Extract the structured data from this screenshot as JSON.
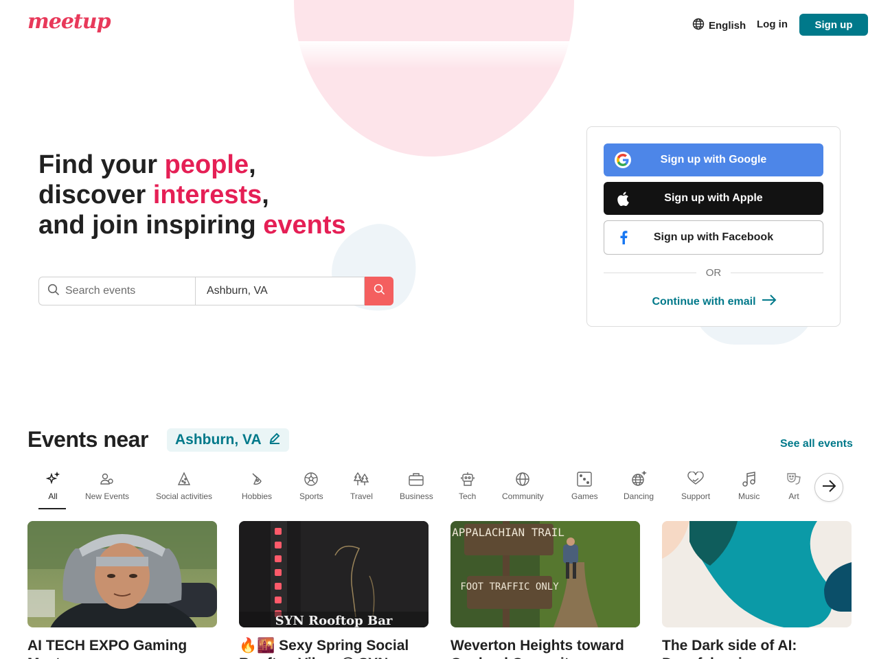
{
  "header": {
    "logo": "meetup",
    "language": "English",
    "login": "Log in",
    "signup": "Sign up"
  },
  "hero": {
    "line1_pre": "Find your ",
    "line1_hl": "people",
    "line1_post": ",",
    "line2_pre": "discover ",
    "line2_hl": "interests",
    "line2_post": ",",
    "line3_pre": "and join inspiring ",
    "line3_hl": "events"
  },
  "search": {
    "placeholder": "Search events",
    "location": "Ashburn, VA"
  },
  "signup_card": {
    "google": "Sign up with Google",
    "apple": "Sign up with Apple",
    "facebook": "Sign up with Facebook",
    "or": "OR",
    "email": "Continue with email"
  },
  "events": {
    "title": "Events near",
    "location": "Ashburn, VA",
    "see_all": "See all events",
    "categories": [
      {
        "label": "All",
        "icon": "sparkle-icon",
        "active": true
      },
      {
        "label": "New Events",
        "icon": "new-people-icon"
      },
      {
        "label": "Social activities",
        "icon": "party-hat-icon"
      },
      {
        "label": "Hobbies",
        "icon": "palette-icon"
      },
      {
        "label": "Sports",
        "icon": "soccer-ball-icon"
      },
      {
        "label": "Travel",
        "icon": "trees-icon"
      },
      {
        "label": "Business",
        "icon": "briefcase-icon"
      },
      {
        "label": "Tech",
        "icon": "robot-icon"
      },
      {
        "label": "Community",
        "icon": "globe-icon"
      },
      {
        "label": "Games",
        "icon": "dice-icon"
      },
      {
        "label": "Dancing",
        "icon": "disco-ball-icon"
      },
      {
        "label": "Support",
        "icon": "heart-hands-icon"
      },
      {
        "label": "Music",
        "icon": "music-note-icon"
      },
      {
        "label": "Art",
        "icon": "theater-masks-icon"
      }
    ],
    "cards": [
      {
        "title": "AI TECH EXPO Gaming Meet"
      },
      {
        "title": "🔥🌇 Sexy Spring Social Rooftop Vibes @ SYN",
        "image_text": "SYN Rooftop Bar"
      },
      {
        "title": "Weverton Heights toward Gapland Campsite",
        "image_text_1": "APPALACHIAN TRAIL",
        "image_text_2": "FOOT TRAFFIC ONLY"
      },
      {
        "title": "The Dark side of AI: Deepfakes in"
      }
    ]
  },
  "colors": {
    "brand_pink": "#e51f55",
    "teal": "#00798a",
    "google_blue": "#4d86e8",
    "search_red": "#f45f5f"
  }
}
